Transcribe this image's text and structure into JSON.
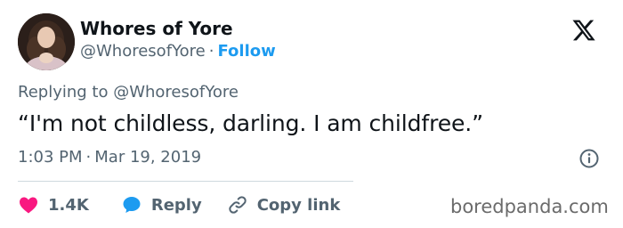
{
  "tweet": {
    "display_name": "Whores of Yore",
    "handle": "@WhoresofYore",
    "separator": "·",
    "follow_label": "Follow",
    "reply_context": "Replying to @WhoresofYore",
    "text": "“I'm not childless, darling. I am childfree.”",
    "time": "1:03 PM",
    "date": "Mar 19, 2019"
  },
  "actions": {
    "like_count": "1.4K",
    "reply_label": "Reply",
    "copy_link_label": "Copy link"
  },
  "watermark": "boredpanda.com",
  "icons": {
    "avatar": "avatar-portrait",
    "logo": "x-logo-icon",
    "info": "info-icon",
    "like": "heart-icon",
    "reply": "speech-bubble-icon",
    "copy": "link-icon"
  },
  "colors": {
    "text": "#0f1419",
    "secondary": "#536471",
    "accent": "#1d9bf0",
    "like": "#f91880",
    "divider": "#cfd9de"
  }
}
